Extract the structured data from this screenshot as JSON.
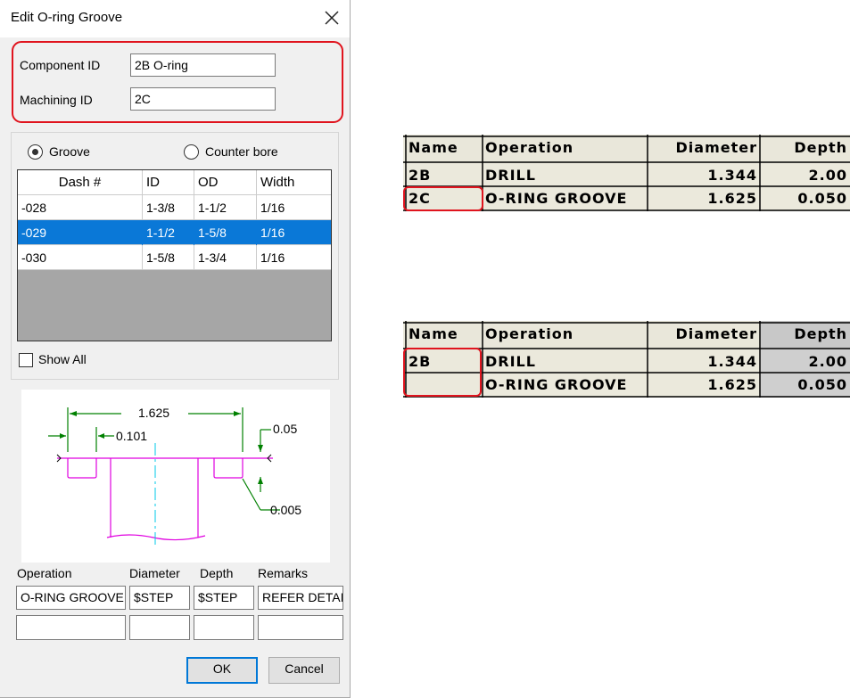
{
  "dialog": {
    "title": "Edit O-ring Groove",
    "component_id_label": "Component ID",
    "component_id_value": "2B O-ring",
    "machining_id_label": "Machining ID",
    "machining_id_value": "2C",
    "radio_groove": "Groove",
    "radio_counterbore": "Counter bore",
    "grid": {
      "headers": [
        "Dash #",
        "ID",
        "OD",
        "Width"
      ],
      "rows": [
        [
          "-028",
          "1-3/8",
          "1-1/2",
          "1/16"
        ],
        [
          "-029",
          "1-1/2",
          "1-5/8",
          "1/16"
        ],
        [
          "-030",
          "1-5/8",
          "1-3/4",
          "1/16"
        ]
      ],
      "selected_row": 1
    },
    "show_all_label": "Show All",
    "sketch": {
      "dim_top": "1.625",
      "dim_left": "0.101",
      "dim_right_top": "0.05",
      "dim_right_bottom": "0.005"
    },
    "ops_headers": {
      "operation": "Operation",
      "diameter": "Diameter",
      "depth": "Depth",
      "remarks": "Remarks"
    },
    "ops_row1": {
      "operation": "O-RING GROOVE",
      "diameter": "$STEP",
      "depth": "$STEP",
      "remarks": "REFER DETAIL"
    },
    "ops_row2": {
      "operation": "",
      "diameter": "",
      "depth": "",
      "remarks": ""
    },
    "ok_label": "OK",
    "cancel_label": "Cancel"
  },
  "table_top": {
    "headers": [
      "Name",
      "Operation",
      "Diameter",
      "Depth"
    ],
    "rows": [
      [
        "2B",
        "DRILL",
        "1.344",
        "2.00"
      ],
      [
        "2C",
        "O-RING GROOVE",
        "1.625",
        "0.050"
      ]
    ]
  },
  "table_bottom": {
    "headers": [
      "Name",
      "Operation",
      "Diameter",
      "Depth"
    ],
    "rows": [
      [
        "2B",
        "DRILL",
        "1.344",
        "2.00"
      ],
      [
        "",
        "O-RING GROOVE",
        "1.625",
        "0.050"
      ]
    ]
  },
  "colors": {
    "highlight": "#e0141e",
    "selection": "#0a78d7",
    "sketch_magenta": "#e000e0",
    "sketch_green": "#008000"
  }
}
